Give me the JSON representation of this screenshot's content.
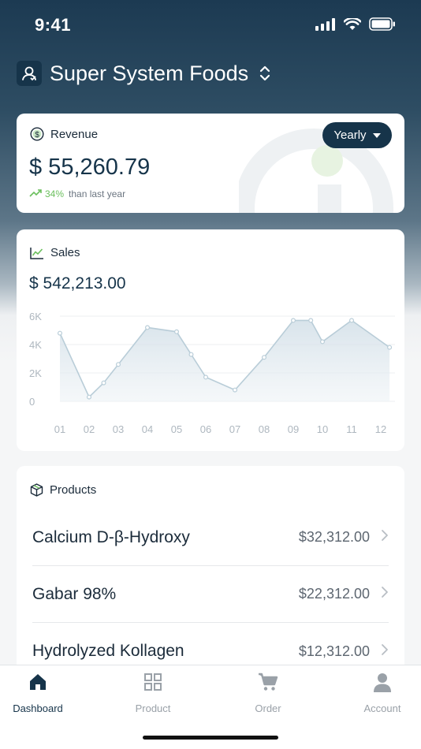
{
  "status": {
    "time": "9:41"
  },
  "header": {
    "org_name": "Super System Foods"
  },
  "revenue": {
    "title": "Revenue",
    "period_button": "Yearly",
    "amount": "$ 55,260.79",
    "change_pct": "34%",
    "change_note": "than last year"
  },
  "sales": {
    "title": "Sales",
    "amount": "$ 542,213.00"
  },
  "chart_data": {
    "type": "area",
    "x": [
      "01",
      "02",
      "03",
      "04",
      "05",
      "06",
      "07",
      "08",
      "09",
      "10",
      "11",
      "12"
    ],
    "series": [
      {
        "values": [
          4800,
          300,
          1300,
          2600,
          5200,
          4900,
          3300,
          1700,
          800,
          3100,
          5700,
          5700,
          4200,
          5700,
          3800
        ]
      }
    ],
    "point_positions": [
      1,
      2,
      2.5,
      3,
      4,
      5,
      5.5,
      6,
      7,
      8,
      9,
      9.6,
      10,
      11,
      12.3
    ],
    "yticks": [
      "6K",
      "4K",
      "2K",
      "0"
    ],
    "ylim": [
      0,
      6000
    ],
    "grid": true,
    "color": "#b9cdd8"
  },
  "products": {
    "title": "Products",
    "items": [
      {
        "name": "Calcium D-β-Hydroxy",
        "price": "$32,312.00"
      },
      {
        "name": "Gabar 98%",
        "price": "$22,312.00"
      },
      {
        "name": "Hydrolyzed Kollagen",
        "price": "$12,312.00"
      }
    ]
  },
  "tabs": [
    {
      "label": "Dashboard",
      "icon": "home-icon",
      "active": true
    },
    {
      "label": "Product",
      "icon": "grid-icon",
      "active": false
    },
    {
      "label": "Order",
      "icon": "cart-icon",
      "active": false
    },
    {
      "label": "Account",
      "icon": "person-icon",
      "active": false
    }
  ],
  "colors": {
    "brand": "#16344a",
    "positive": "#6abf5c"
  }
}
